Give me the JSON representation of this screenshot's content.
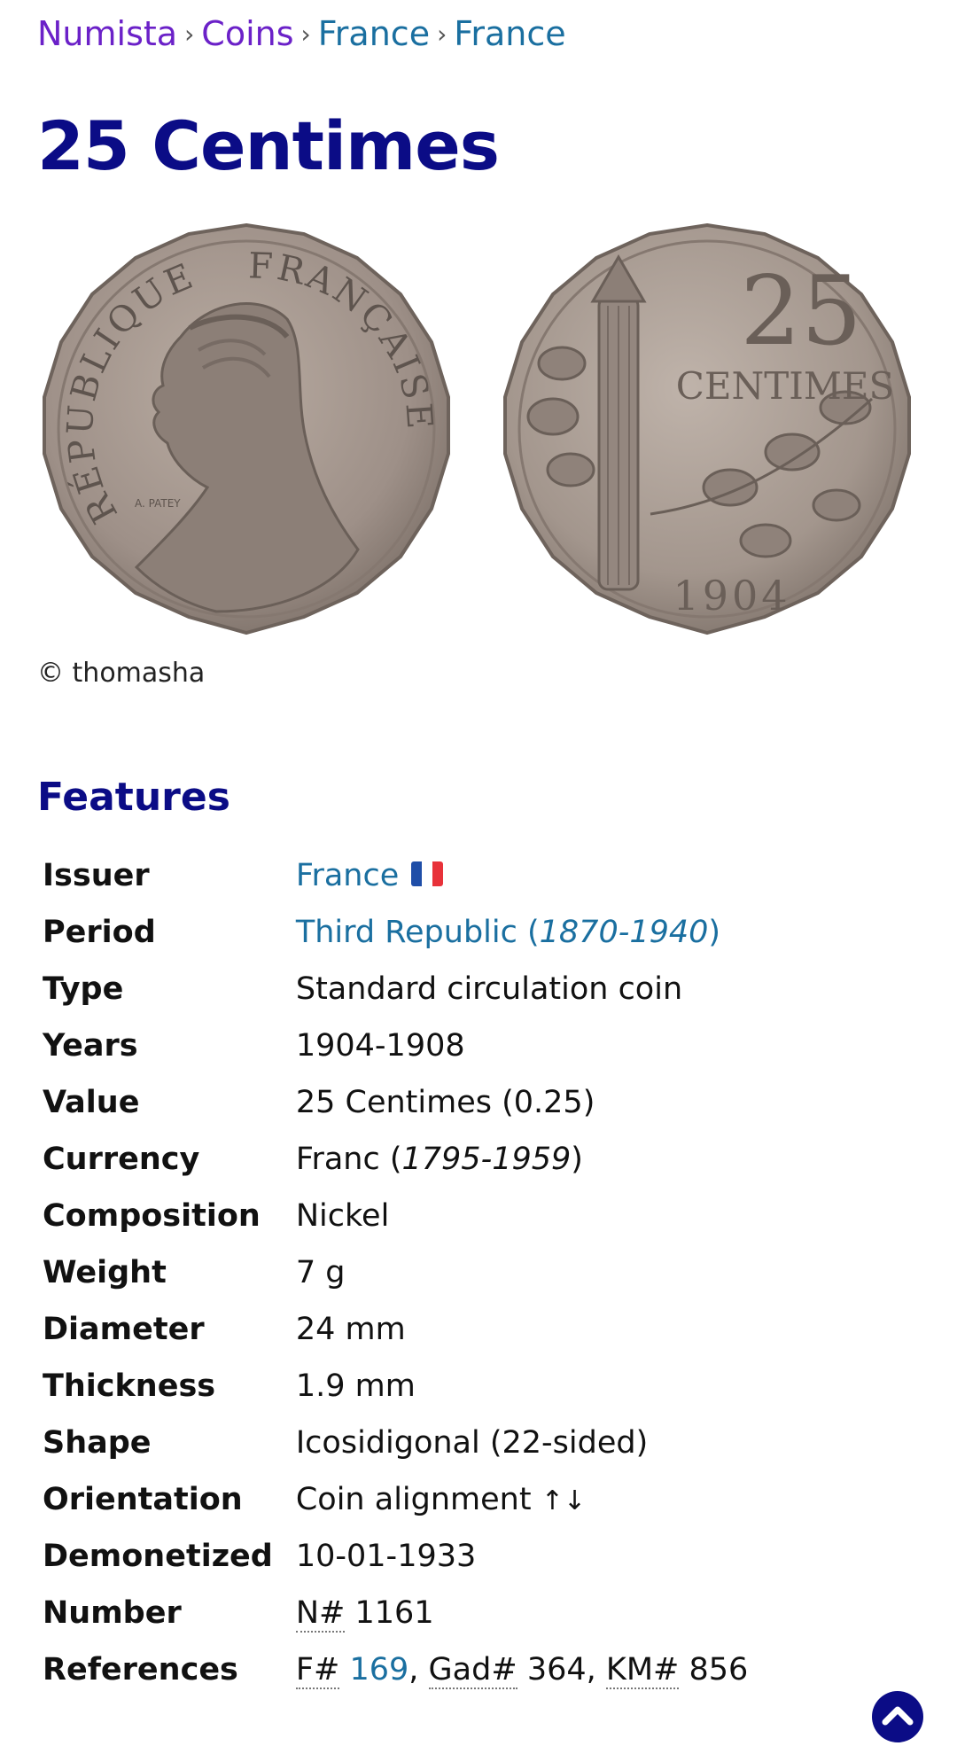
{
  "breadcrumb": {
    "items": [
      {
        "label": "Numista",
        "visited": true
      },
      {
        "label": "Coins",
        "visited": true
      },
      {
        "label": "France",
        "visited": false
      },
      {
        "label": "France",
        "visited": false
      }
    ],
    "separator": "›"
  },
  "title": "25 Centimes",
  "images": {
    "obverse": {
      "legend_left": "RÉPUBLIQUE",
      "legend_right": "FRANÇAISE",
      "engraver": "A. PATEY"
    },
    "reverse": {
      "denomination": "25",
      "unit": "CENTIMES",
      "year": "1904"
    },
    "copyright": "© thomasha"
  },
  "features": {
    "heading": "Features",
    "issuer": {
      "label": "Issuer",
      "value": "France",
      "flag_colors": [
        "#1f4ea8",
        "#ffffff",
        "#e8323a"
      ]
    },
    "period": {
      "label": "Period",
      "value": "Third Republic",
      "range": "1870-1940"
    },
    "type": {
      "label": "Type",
      "value": "Standard circulation coin"
    },
    "years": {
      "label": "Years",
      "value": "1904-1908"
    },
    "value": {
      "label": "Value",
      "value": "25 Centimes (0.25)"
    },
    "currency": {
      "label": "Currency",
      "value": "Franc",
      "range": "1795-1959"
    },
    "composition": {
      "label": "Composition",
      "value": "Nickel"
    },
    "weight": {
      "label": "Weight",
      "value": "7 g"
    },
    "diameter": {
      "label": "Diameter",
      "value": "24 mm"
    },
    "thickness": {
      "label": "Thickness",
      "value": "1.9 mm"
    },
    "shape": {
      "label": "Shape",
      "value": "Icosidigonal (22-sided)"
    },
    "orientation": {
      "label": "Orientation",
      "value": "Coin alignment",
      "arrows": "↑↓"
    },
    "demonetized": {
      "label": "Demonetized",
      "value": "10-01-1933"
    },
    "number": {
      "label": "Number",
      "prefix": "N#",
      "value": "1161"
    },
    "references": {
      "label": "References",
      "f_prefix": "F#",
      "f_value": "169",
      "gad_prefix": "Gad#",
      "gad_value": "364",
      "km_prefix": "KM#",
      "km_value": "856"
    }
  },
  "colors": {
    "title": "#0b0c86",
    "link": "#1a6fa0",
    "visited": "#6b21c8"
  },
  "scroll_top_icon": "chevron-up-icon"
}
